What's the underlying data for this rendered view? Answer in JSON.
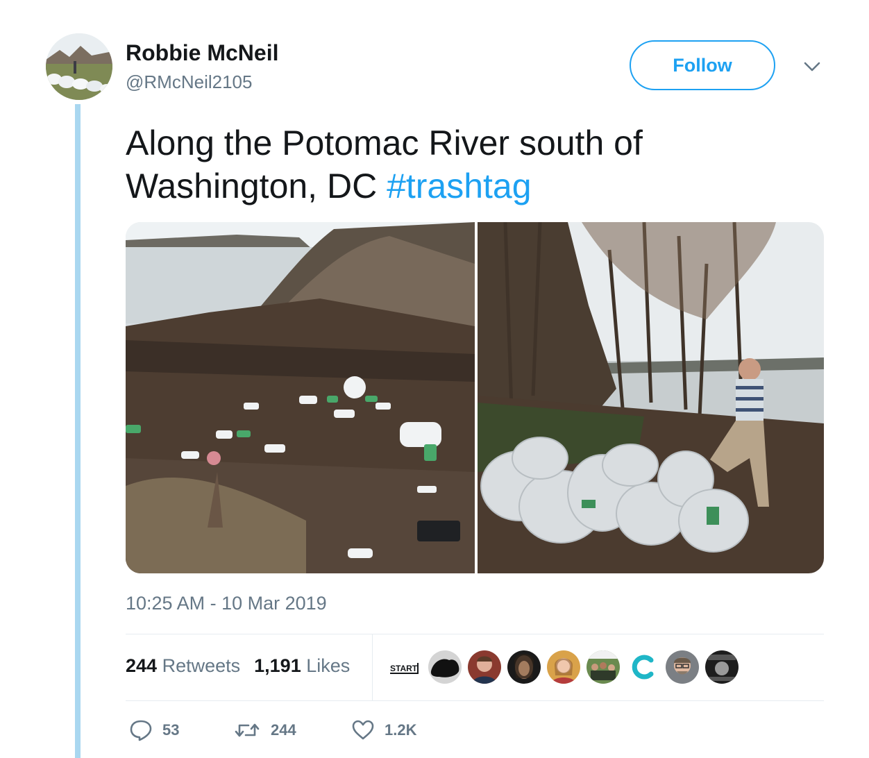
{
  "user": {
    "display_name": "Robbie McNeil",
    "handle": "@RMcNeil2105",
    "avatar_icon": "avatar-photo"
  },
  "follow_label": "Follow",
  "tweet": {
    "text": "Along the Potomac River south of Washington, DC ",
    "hashtag": "#trashtag"
  },
  "media": [
    {
      "icon": "photo-riverbank-trash"
    },
    {
      "icon": "photo-man-with-trash-bags"
    }
  ],
  "timestamp": "10:25 AM - 10 Mar 2019",
  "stats": {
    "retweets_count": "244",
    "retweets_label": "Retweets",
    "likes_count": "1,191",
    "likes_label": "Likes"
  },
  "likers": [
    {
      "name": "START",
      "icon": "start-logo-icon"
    },
    {
      "icon": "dark-splash-avatar"
    },
    {
      "icon": "man-avatar"
    },
    {
      "icon": "native-portrait-avatar"
    },
    {
      "icon": "woman-avatar"
    },
    {
      "icon": "group-photo-avatar"
    },
    {
      "icon": "c-logo-icon"
    },
    {
      "icon": "man-glasses-avatar"
    },
    {
      "icon": "poster-avatar"
    }
  ],
  "actions": {
    "replies": "53",
    "retweets": "244",
    "likes": "1.2K"
  },
  "colors": {
    "accent": "#1da1f2",
    "muted": "#657786",
    "thread_line": "#a9d7f0"
  }
}
